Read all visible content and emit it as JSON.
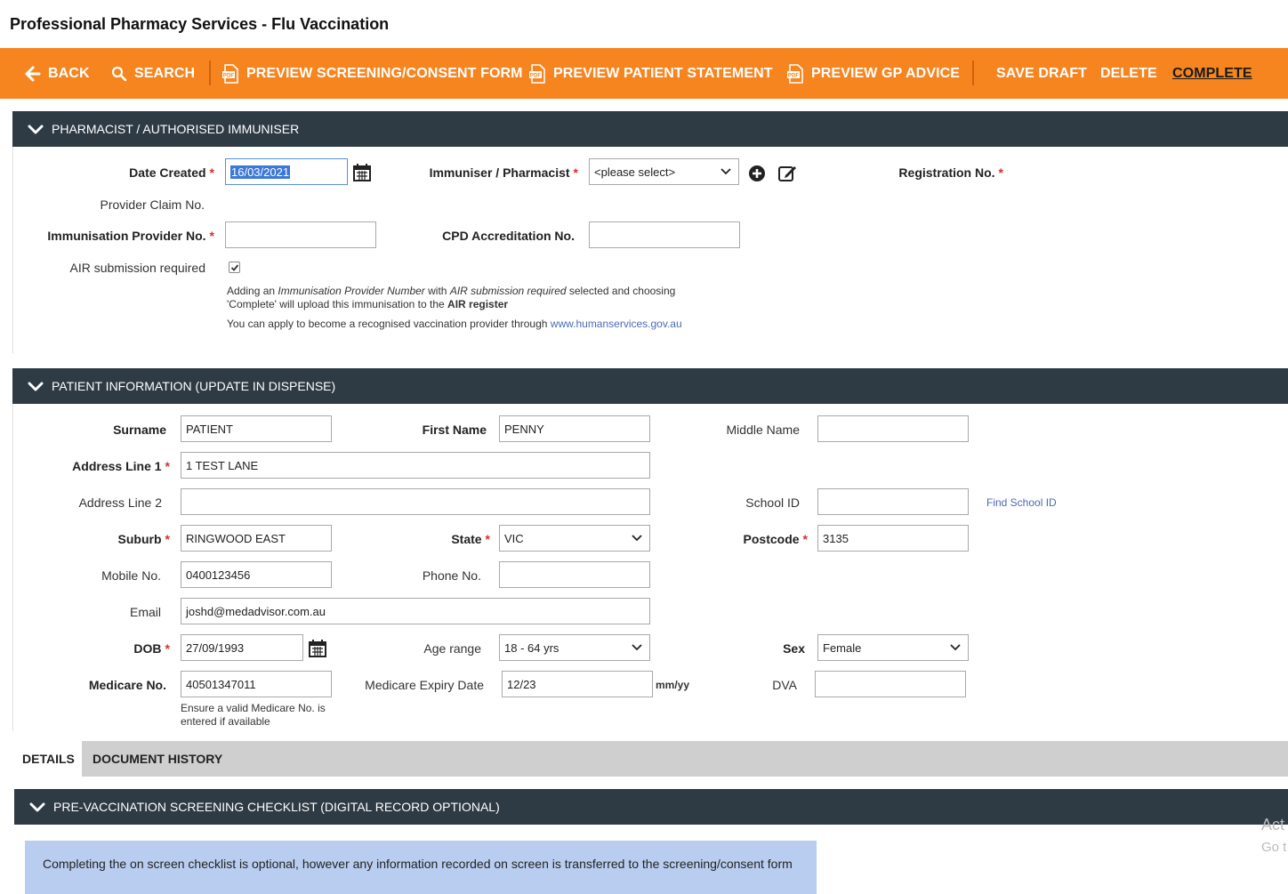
{
  "page": {
    "title": "Professional Pharmacy Services - Flu Vaccination"
  },
  "toolbar": {
    "back": "BACK",
    "search": "SEARCH",
    "preview_screening": "PREVIEW SCREENING/CONSENT FORM",
    "preview_patient": "PREVIEW PATIENT STATEMENT",
    "preview_gp": "PREVIEW GP ADVICE",
    "save_draft": "SAVE DRAFT",
    "delete": "DELETE",
    "complete": "COMPLETE",
    "pdf_badge": "PDF"
  },
  "pharmacist": {
    "section_title": "PHARMACIST / AUTHORISED IMMUNISER",
    "date_created_label": "Date Created",
    "date_created_value": "16/03/2021",
    "immuniser_label": "Immuniser / Pharmacist",
    "immuniser_value": "<please select>",
    "registration_label": "Registration No.",
    "provider_claim_label": "Provider Claim No.",
    "immunisation_provider_label": "Immunisation Provider No.",
    "cpd_label": "CPD Accreditation No.",
    "air_label": "AIR submission required",
    "note_p1": "Adding an ",
    "note_i1": "Immunisation Provider Number",
    "note_p2": " with ",
    "note_i2": "AIR submission required",
    "note_p3": " selected and choosing",
    "note_line2": "'Complete' will upload this immunisation to the ",
    "note_bold": "AIR register",
    "apply_text": "You can apply to become a recognised vaccination provider through ",
    "apply_link": "www.humanservices.gov.au"
  },
  "patient": {
    "section_title": "PATIENT INFORMATION (UPDATE IN DISPENSE)",
    "surname_label": "Surname",
    "surname_value": "PATIENT",
    "first_name_label": "First Name",
    "first_name_value": "PENNY",
    "middle_name_label": "Middle Name",
    "middle_name_value": "",
    "address1_label": "Address Line 1",
    "address1_value": "1 TEST LANE",
    "address2_label": "Address Line 2",
    "address2_value": "",
    "school_id_label": "School ID",
    "school_id_value": "",
    "find_school_link": "Find School ID",
    "suburb_label": "Suburb",
    "suburb_value": "RINGWOOD EAST",
    "state_label": "State",
    "state_value": "VIC",
    "postcode_label": "Postcode",
    "postcode_value": "3135",
    "mobile_label": "Mobile No.",
    "mobile_value": "0400123456",
    "phone_label": "Phone No.",
    "phone_value": "",
    "email_label": "Email",
    "email_value": "joshd@medadvisor.com.au",
    "dob_label": "DOB",
    "dob_value": "27/09/1993",
    "age_range_label": "Age range",
    "age_range_value": "18 - 64 yrs",
    "sex_label": "Sex",
    "sex_value": "Female",
    "medicare_label": "Medicare No.",
    "medicare_value": "40501347011",
    "medicare_hint_1": "Ensure a valid Medicare No. is",
    "medicare_hint_2": "entered if available",
    "medicare_expiry_label": "Medicare Expiry Date",
    "medicare_expiry_value": "12/23",
    "mmyy": "mm/yy",
    "dva_label": "DVA",
    "dva_value": ""
  },
  "tabs": [
    {
      "label": "DETAILS",
      "active": true
    },
    {
      "label": "DOCUMENT HISTORY",
      "active": false
    }
  ],
  "screening": {
    "section_title": "PRE-VACCINATION SCREENING CHECKLIST (DIGITAL RECORD OPTIONAL)",
    "info_text": "Completing the on screen checklist is optional, however any information recorded on screen is transferred to the screening/consent form"
  },
  "watermark": {
    "line1": "Act",
    "line2": "Go t"
  },
  "colors": {
    "toolbar": "#f7851f",
    "section_bar": "#2e3a44",
    "required": "#d9302c",
    "info_box": "#b9cdf0",
    "link": "#4a6bb6"
  }
}
